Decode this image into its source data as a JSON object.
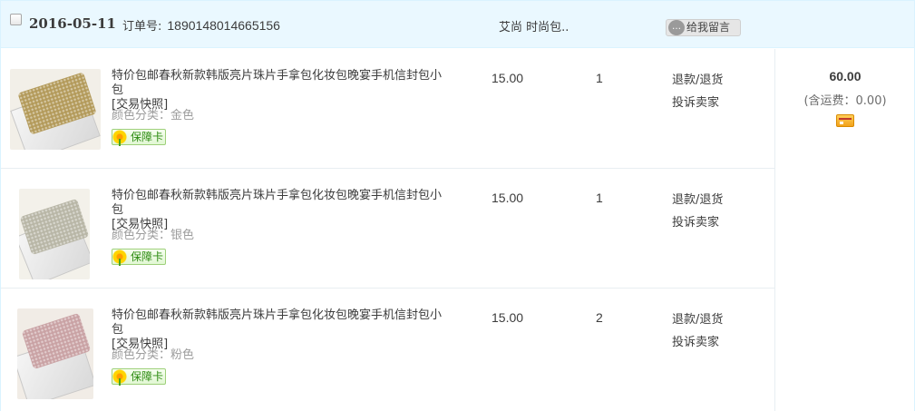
{
  "header": {
    "date": "2016-05-11",
    "order_label": "订单号:",
    "order_number": "1890148014665156",
    "shop_name": "艾尚 时尚包..",
    "message_button": "给我留言"
  },
  "items": [
    {
      "title": "特价包邮春秋新款韩版亮片珠片手拿包化妆包晚宴手机信封包小包",
      "snapshot": "[交易快照]",
      "variant": "颜色分类：金色",
      "badge": "保障卡",
      "price": "15.00",
      "quantity": "1",
      "refund": "退款/退货",
      "complain": "投诉卖家",
      "bag_color": "#b39a5a"
    },
    {
      "title": "特价包邮春秋新款韩版亮片珠片手拿包化妆包晚宴手机信封包小包",
      "snapshot": "[交易快照]",
      "variant": "颜色分类：银色",
      "badge": "保障卡",
      "price": "15.00",
      "quantity": "1",
      "refund": "退款/退货",
      "complain": "投诉卖家",
      "bag_color": "#b8b6a6"
    },
    {
      "title": "特价包邮春秋新款韩版亮片珠片手拿包化妆包晚宴手机信封包小包",
      "snapshot": "[交易快照]",
      "variant": "颜色分类：粉色",
      "badge": "保障卡",
      "price": "15.00",
      "quantity": "2",
      "refund": "退款/退货",
      "complain": "投诉卖家",
      "bag_color": "#c9a2a4"
    }
  ],
  "summary": {
    "total": "60.00",
    "shipping": "(含运费：0.00)",
    "pay_icon": "payment-card-icon"
  }
}
